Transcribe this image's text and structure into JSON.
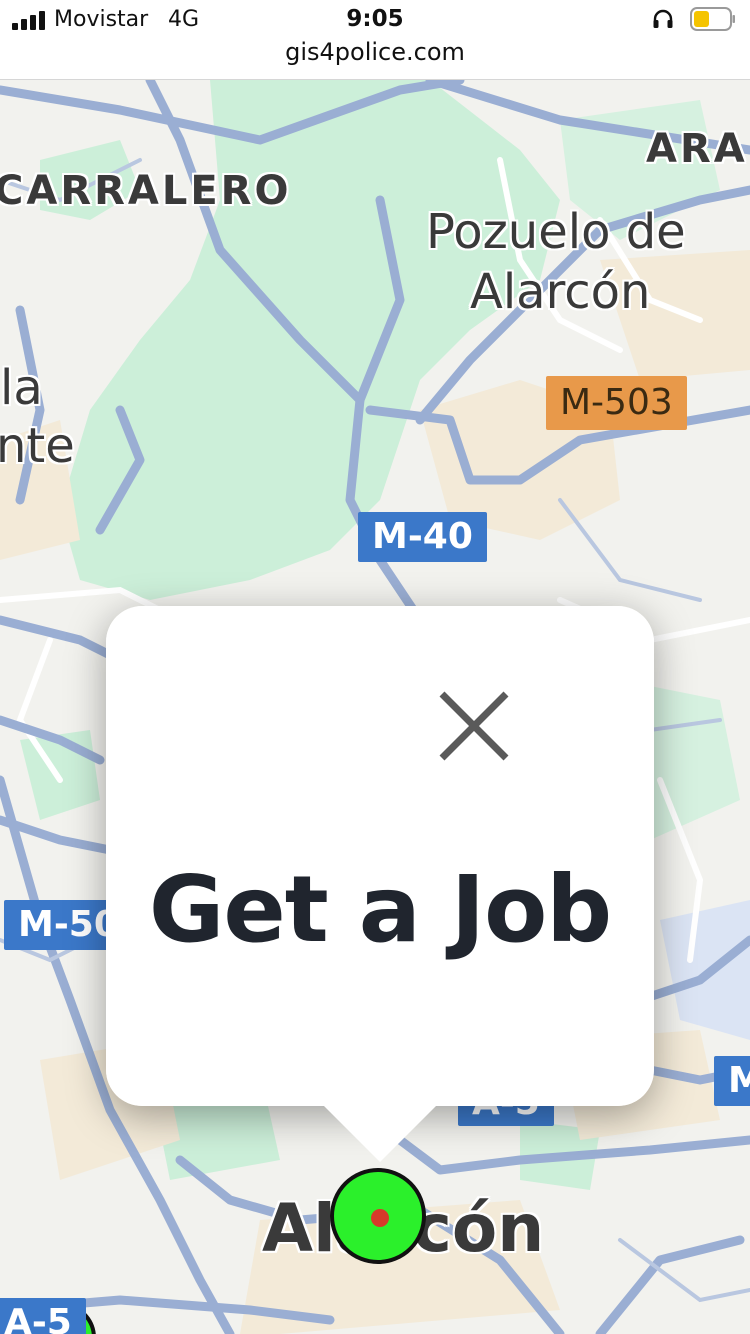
{
  "status_bar": {
    "carrier": "Movistar",
    "network": "4G",
    "time": "9:05",
    "url": "gis4police.com",
    "battery_color": "#f5c400"
  },
  "map": {
    "place_labels": {
      "carralero": "CARRALERO",
      "aravaca": "ARA",
      "pozuelo_line1": "Pozuelo de",
      "pozuelo_line2": "Alarcón",
      "la": "la",
      "nte": "nte",
      "alarcon": "Alarcón"
    },
    "road_shields": {
      "m503": "M-503",
      "m40": "M-40",
      "m50": "M-50",
      "a5_center": "A-5",
      "a5_left": "A-5",
      "m_right": "M"
    },
    "colors": {
      "road_blue": "#9aaed3",
      "shield_blue": "#3b78c9",
      "shield_orange": "#e8994a",
      "park_green": "#ccefd9",
      "land": "#f2f2ee"
    }
  },
  "popup": {
    "title": "Get a Job",
    "close_icon": "close-icon"
  },
  "marker": {
    "icon": "location-marker-icon",
    "fill_color": "#2bf02b",
    "center_color": "#d63a2a"
  }
}
